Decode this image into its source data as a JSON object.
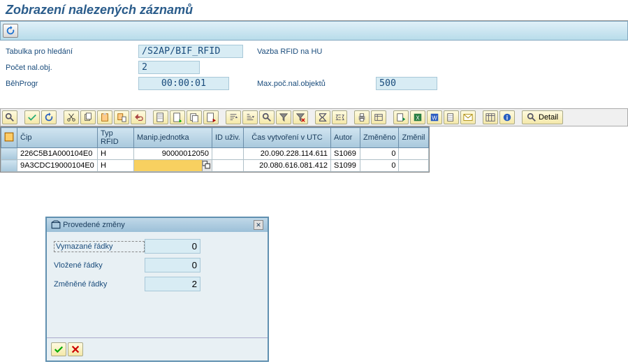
{
  "title": "Zobrazení nalezených záznamů",
  "fields": {
    "table_search_lbl": "Tabulka pro hledání",
    "table_search_val": "/S2AP/BIF_RFID",
    "relation_text": "Vazba RFID na HU",
    "count_lbl": "Počet nal.obj.",
    "count_val": "2",
    "runtime_lbl": "BěhProgr",
    "runtime_val": "00:00:01",
    "max_lbl": "Max.poč.nal.objektů",
    "max_val": "500"
  },
  "grid": {
    "headers": [
      "Čip",
      "Typ RFID",
      "Manip.jednotka",
      "ID uživ.",
      "Čas vytvoření v UTC",
      "Autor",
      "Změněno",
      "Změnil"
    ],
    "rows": [
      {
        "chip": "226C5B1A000104E0",
        "type": "H",
        "mj": "90000012050",
        "idu": "",
        "time": "20.090.228.114.611",
        "author": "S1069",
        "changed": "0",
        "changer": ""
      },
      {
        "chip": "9A3CDC19000104E0",
        "type": "H",
        "mj": "",
        "idu": "",
        "time": "20.080.616.081.412",
        "author": "S1099",
        "changed": "0",
        "changer": ""
      }
    ],
    "detail_btn": "Detail"
  },
  "dialog": {
    "title": "Provedené změny",
    "deleted_lbl": "Vymazané řádky",
    "deleted_val": "0",
    "inserted_lbl": "Vložené řádky",
    "inserted_val": "0",
    "changed_lbl": "Změněné řádky",
    "changed_val": "2"
  }
}
